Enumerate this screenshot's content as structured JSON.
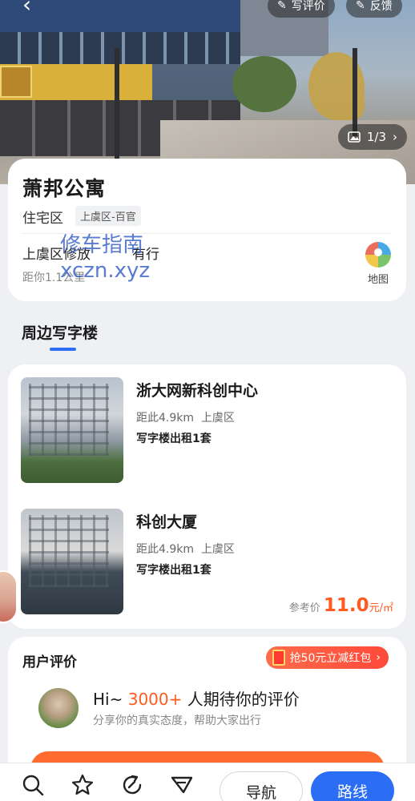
{
  "header": {
    "write_review_label": "写评价",
    "feedback_label": "反馈",
    "photo_counter": "1/3"
  },
  "place": {
    "name": "萧邦公寓",
    "type": "住宅区",
    "region": "上虞区-百官",
    "address": "上虞区修放",
    "address_tail": "有行",
    "distance": "距你1.1公里",
    "map_label": "地图"
  },
  "watermark": {
    "line1": "修车指南",
    "line2": "xczn.xyz"
  },
  "section": {
    "title": "周边写字楼"
  },
  "offices": [
    {
      "name": "浙大网新科创中心",
      "distance": "距此4.9km",
      "district": "上虞区",
      "rent": "写字楼出租1套"
    },
    {
      "name": "科创大厦",
      "distance": "距此4.9km",
      "district": "上虞区",
      "rent": "写字楼出租1套"
    }
  ],
  "reference_price": {
    "label": "参考价",
    "value": "11.0",
    "unit": "元/㎡"
  },
  "reviews": {
    "title": "用户评价",
    "coupon": "抢50元立减红包",
    "greeting_prefix": "Hi~",
    "count": "3000+",
    "greeting_suffix": "人期待你的评价",
    "subtitle": "分享你的真实态度，帮助大家出行"
  },
  "bottom_bar": {
    "nav_label": "导航",
    "route_label": "路线"
  },
  "colors": {
    "accent_blue": "#2b6ef5",
    "accent_orange": "#ff5a1f"
  }
}
